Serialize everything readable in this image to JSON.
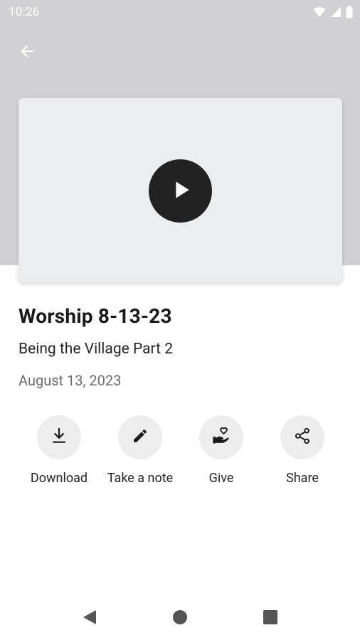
{
  "status_bar": {
    "time": "10:26",
    "icons": [
      "wifi-icon",
      "signal-icon",
      "battery-icon"
    ]
  },
  "header": {
    "back_icon": "arrow-back-icon",
    "background_color": "#d1d1d3"
  },
  "video": {
    "play_icon": "play-icon",
    "thumbnail_color": "#ebedef"
  },
  "content": {
    "title": "Worship 8-13-23",
    "subtitle": "Being the Village Part 2",
    "date": "August 13, 2023"
  },
  "actions": [
    {
      "label": "Download",
      "icon": "download-icon"
    },
    {
      "label": "Take a note",
      "icon": "pencil-icon"
    },
    {
      "label": "Give",
      "icon": "give-heart-hand-icon"
    },
    {
      "label": "Share",
      "icon": "share-icon"
    }
  ],
  "nav": {
    "icons": [
      "nav-back-icon",
      "nav-home-icon",
      "nav-recents-icon"
    ]
  }
}
